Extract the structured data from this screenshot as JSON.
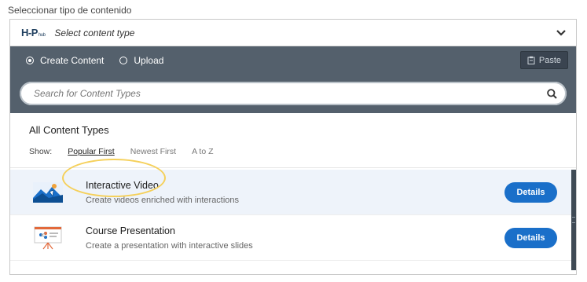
{
  "page_label": "Seleccionar tipo de contenido",
  "hub": {
    "logo_main": "H-P",
    "logo_sub": "hub",
    "title": "Select content type",
    "tabs": [
      {
        "label": "Create Content",
        "selected": true
      },
      {
        "label": "Upload",
        "selected": false
      }
    ],
    "paste_label": "Paste",
    "search_placeholder": "Search for Content Types",
    "types_title": "All Content Types",
    "show_label": "Show:",
    "sort_options": [
      {
        "label": "Popular First",
        "active": true
      },
      {
        "label": "Newest First",
        "active": false
      },
      {
        "label": "A to Z",
        "active": false
      }
    ],
    "items": [
      {
        "name": "Interactive Video",
        "description": "Create videos enriched with interactions",
        "details_label": "Details",
        "icon": "interactive-video-icon"
      },
      {
        "name": "Course Presentation",
        "description": "Create a presentation with interactive slides",
        "details_label": "Details",
        "icon": "course-presentation-icon"
      }
    ]
  },
  "colors": {
    "accent": "#1a6fc9",
    "bar": "#54606c",
    "annotation": "#f5d05a"
  }
}
